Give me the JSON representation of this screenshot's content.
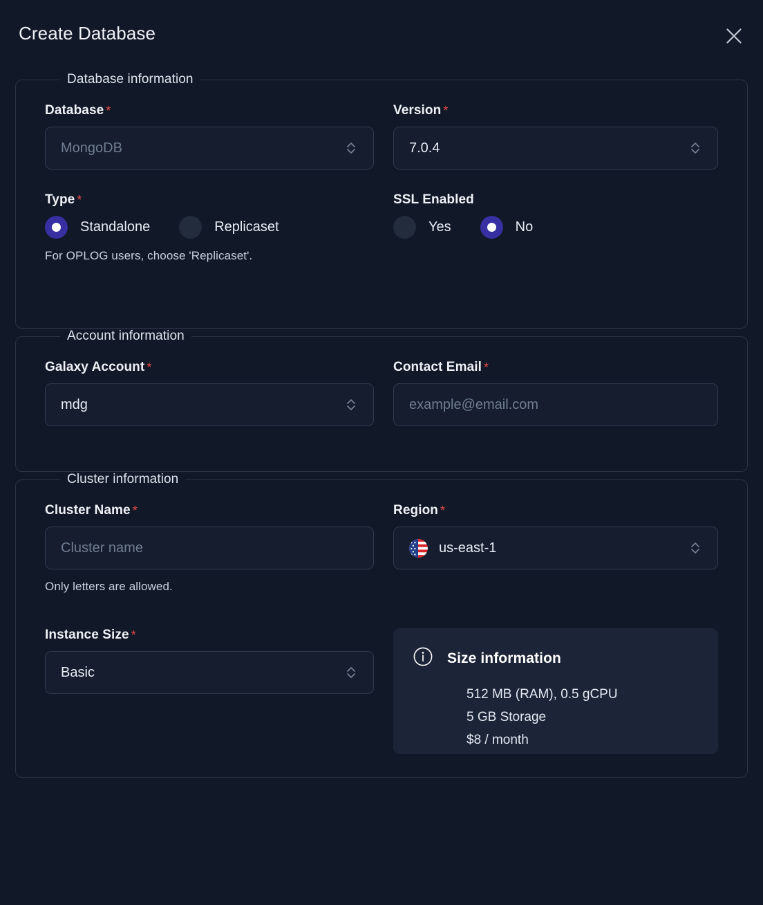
{
  "modal": {
    "title": "Create Database",
    "close_icon": "close-icon"
  },
  "sections": {
    "database": {
      "legend": "Database information",
      "database": {
        "label": "Database",
        "required": "*",
        "value": "MongoDB",
        "is_placeholder": true,
        "icon": "chevron-updown-icon"
      },
      "version": {
        "label": "Version",
        "required": "*",
        "value": "7.0.4",
        "icon": "chevron-updown-icon"
      },
      "type": {
        "label": "Type",
        "required": "*",
        "options": [
          {
            "label": "Standalone",
            "selected": true
          },
          {
            "label": "Replicaset",
            "selected": false
          }
        ],
        "hint": "For OPLOG users, choose 'Replicaset'."
      },
      "ssl": {
        "label": "SSL Enabled",
        "options": [
          {
            "label": "Yes",
            "selected": false
          },
          {
            "label": "No",
            "selected": true
          }
        ]
      }
    },
    "account": {
      "legend": "Account information",
      "galaxy_account": {
        "label": "Galaxy Account",
        "required": "*",
        "value": "mdg",
        "icon": "chevron-updown-icon"
      },
      "contact_email": {
        "label": "Contact Email",
        "required": "*",
        "value": "",
        "placeholder": "example@email.com"
      }
    },
    "cluster": {
      "legend": "Cluster information",
      "cluster_name": {
        "label": "Cluster Name",
        "required": "*",
        "value": "",
        "placeholder": "Cluster name",
        "hint": "Only letters are allowed."
      },
      "region": {
        "label": "Region",
        "required": "*",
        "value": "us-east-1",
        "flag": "us-flag-icon",
        "icon": "chevron-updown-icon"
      },
      "instance_size": {
        "label": "Instance Size",
        "required": "*",
        "value": "Basic",
        "icon": "chevron-updown-icon"
      },
      "size_info": {
        "icon": "info-circle-icon",
        "title": "Size information",
        "lines": [
          "512 MB (RAM), 0.5 gCPU",
          "5 GB Storage",
          "$8 / month"
        ]
      }
    }
  },
  "colors": {
    "page_bg": "#111827",
    "accent": "#3730a3",
    "required": "#e34a4a",
    "border": "#2c3445",
    "info_card_bg": "#1c2537"
  }
}
